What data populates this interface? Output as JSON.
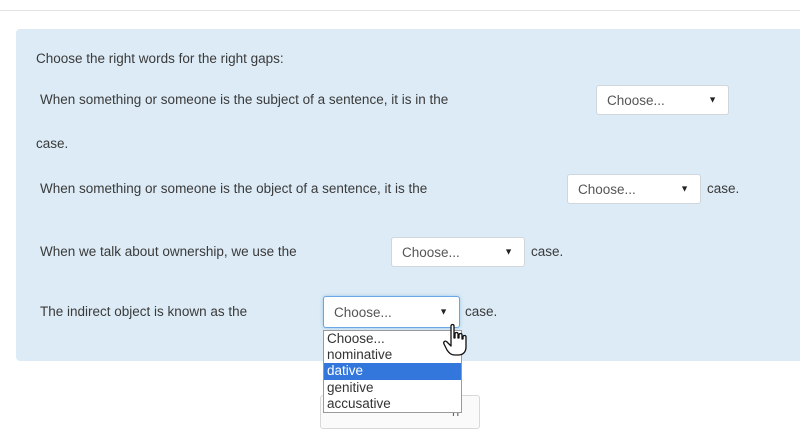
{
  "intro": "Choose the right words for the right gaps:",
  "q1": {
    "before": "When something or someone is the subject of a sentence, it is in the",
    "select": "Choose...",
    "after": "case."
  },
  "q2": {
    "before": "When something or someone is the object of a sentence, it is the",
    "select": "Choose...",
    "after": "case."
  },
  "q3": {
    "before": "When we talk about ownership, we use the",
    "select": "Choose...",
    "after": "case."
  },
  "q4": {
    "before": "The indirect object is known as the",
    "select": "Choose...",
    "after": "case."
  },
  "dropdown": {
    "options": [
      "Choose...",
      "nominative",
      "dative",
      "genitive",
      "accusative"
    ],
    "highlighted": "dative"
  },
  "behind_text": "h",
  "icons": {
    "caret": "caret-down-icon",
    "cursor": "hand-pointer-icon"
  },
  "colors": {
    "panel": "#dcebf5",
    "highlight": "#3377dd",
    "focus": "#69a6e3"
  }
}
